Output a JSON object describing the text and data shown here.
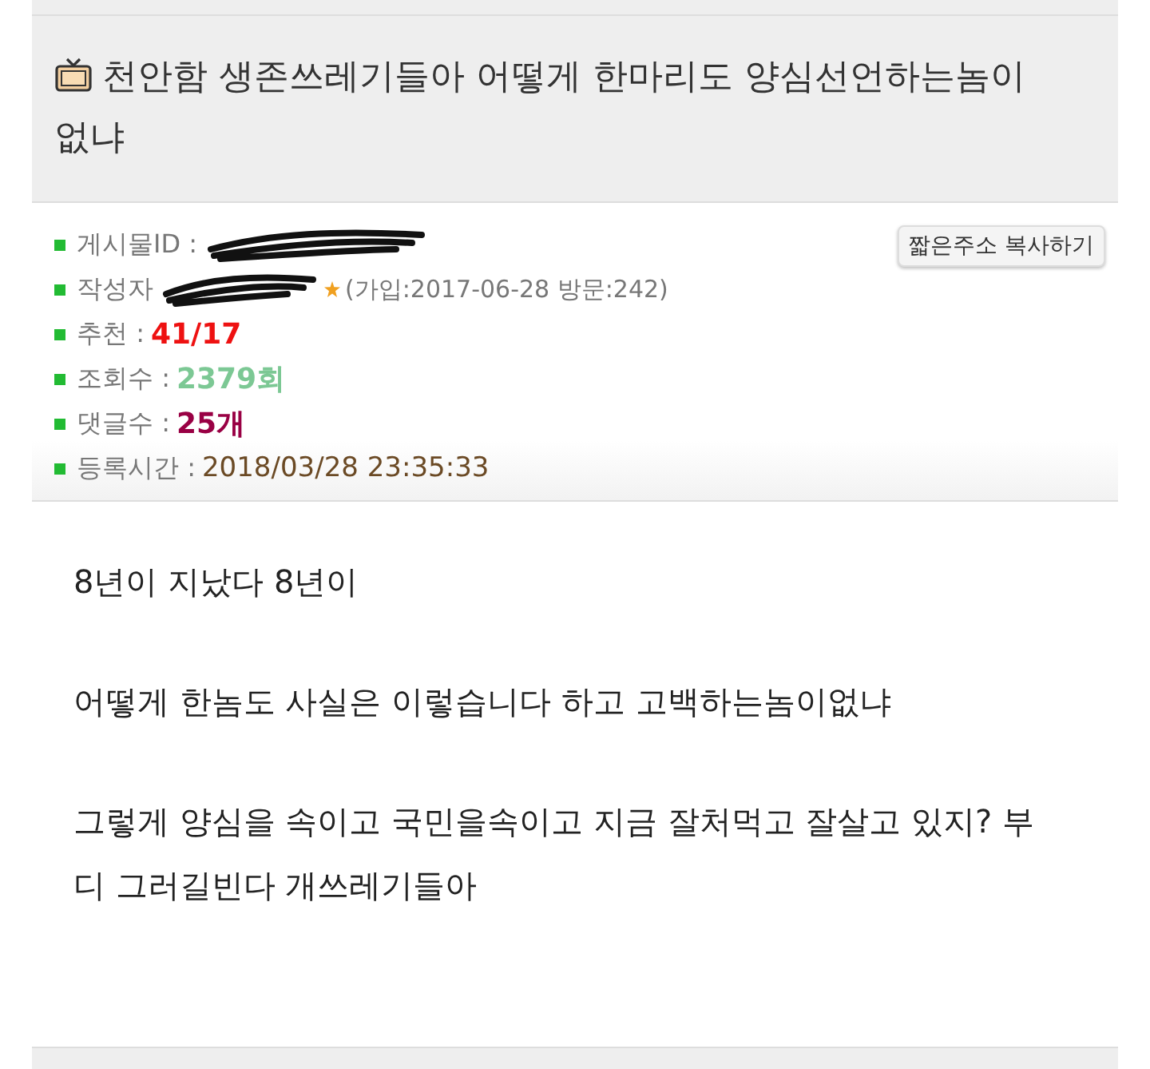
{
  "post": {
    "title": "천안함 생존쓰레기들아 어떻게 한마리도 양심선언하는놈이없냐",
    "meta": [
      {
        "kind": "redacted",
        "label": "게시물ID :"
      },
      {
        "kind": "author",
        "label": "작성자",
        "detail": "(가입:2017-06-28 방문:242)"
      },
      {
        "kind": "value",
        "label": "추천 :",
        "value": "41/17",
        "color": "#ee1111"
      },
      {
        "kind": "value",
        "label": "조회수 :",
        "value": "2379회",
        "color": "#7cc894"
      },
      {
        "kind": "value",
        "label": "댓글수 :",
        "value": "25개",
        "color": "#990044"
      },
      {
        "kind": "plain",
        "label": "등록시간 :",
        "value": "2018/03/28 23:35:33"
      }
    ],
    "copy_button": "짧은주소 복사하기",
    "body": [
      "8년이 지났다 8년이",
      "어떻게 한놈도  사실은 이렇습니다 하고  고백하는놈이없냐",
      "그렇게 양심을 속이고 국민을속이고  지금 잘처먹고 잘살고 있지?  부디 그러길빈다 개쓰레기들아"
    ]
  }
}
